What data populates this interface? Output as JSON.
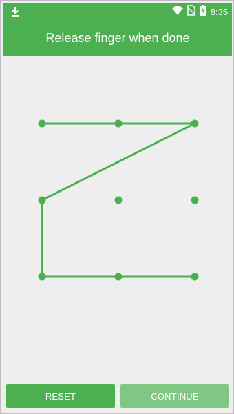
{
  "status_bar": {
    "time": "8:35",
    "icons": [
      "download-icon",
      "wifi-icon",
      "no-sim-icon",
      "battery-charging-icon"
    ]
  },
  "header": {
    "title": "Release finger when done"
  },
  "pattern": {
    "grid_size": 3,
    "selected_sequence": [
      0,
      1,
      2,
      3,
      6,
      7,
      8
    ],
    "color": "#4caf50"
  },
  "buttons": {
    "reset_label": "RESET",
    "continue_label": "CONTINUE"
  },
  "colors": {
    "accent": "#4caf50",
    "accent_disabled": "#81c784",
    "background": "#eeeeee"
  }
}
